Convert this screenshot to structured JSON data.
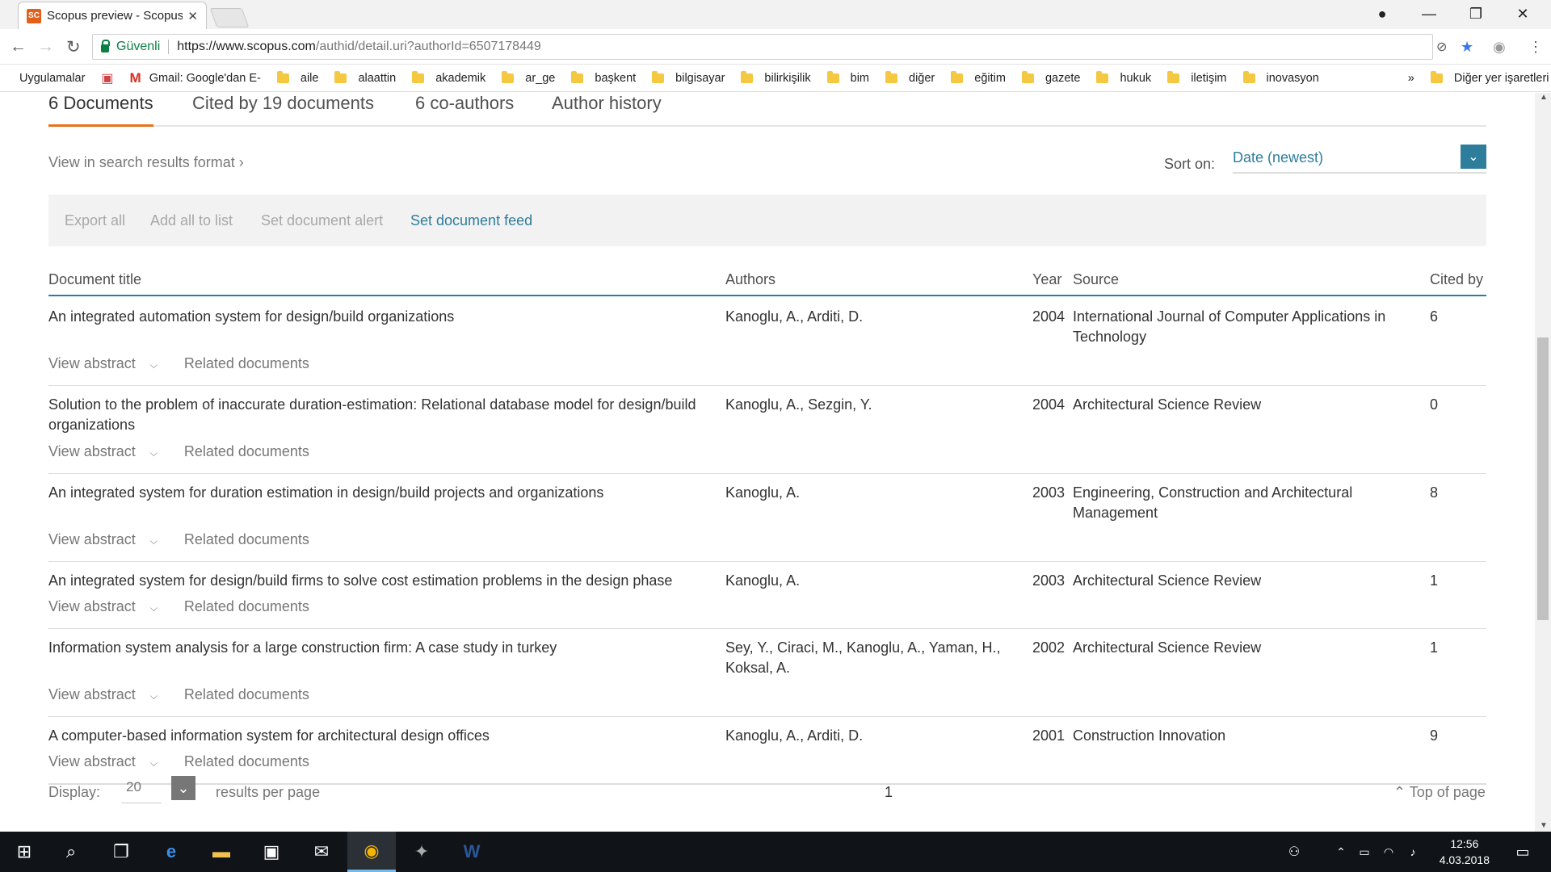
{
  "browser": {
    "tab_title": "Scopus preview - Scopus",
    "favicon_text": "SC",
    "secure_label": "Güvenli",
    "url_main": "https://www.scopus.com",
    "url_path": "/authid/detail.uri?authorId=6507178449"
  },
  "bookmarks": {
    "apps": "Uygulamalar",
    "gmail": "Gmail: Google'dan E-",
    "folders": [
      "aile",
      "alaattin",
      "akademik",
      "ar_ge",
      "başkent",
      "bilgisayar",
      "bilirkişilik",
      "bim",
      "diğer",
      "eğitim",
      "gazete",
      "hukuk",
      "iletişim",
      "inovasyon"
    ],
    "more": "»",
    "other": "Diğer yer işaretleri"
  },
  "tabs": [
    "6 Documents",
    "Cited by 19 documents",
    "6 co-authors",
    "Author history"
  ],
  "view_search": "View in search results format",
  "sort": {
    "label": "Sort on:",
    "value": "Date (newest)"
  },
  "actions": {
    "export": "Export all",
    "add": "Add all to list",
    "alert": "Set document alert",
    "feed": "Set document feed"
  },
  "columns": {
    "title": "Document title",
    "authors": "Authors",
    "year": "Year",
    "source": "Source",
    "cited": "Cited by"
  },
  "row_links": {
    "abstract": "View abstract",
    "related": "Related documents"
  },
  "documents": [
    {
      "title": "An integrated automation system for design/build organizations",
      "authors": "Kanoglu, A., Arditi, D.",
      "year": "2004",
      "source": "International Journal of Computer Applications in Technology",
      "cited": "6"
    },
    {
      "title": "Solution to the problem of inaccurate duration-estimation: Relational database model for design/build organizations",
      "authors": "Kanoglu, A., Sezgin, Y.",
      "year": "2004",
      "source": "Architectural Science Review",
      "cited": "0"
    },
    {
      "title": "An integrated system for duration estimation in design/build projects and organizations",
      "authors": "Kanoglu, A.",
      "year": "2003",
      "source": "Engineering, Construction and Architectural Management",
      "cited": "8"
    },
    {
      "title": "An integrated system for design/build firms to solve cost estimation problems in the design phase",
      "authors": "Kanoglu, A.",
      "year": "2003",
      "source": "Architectural Science Review",
      "cited": "1"
    },
    {
      "title": "Information system analysis for a large construction firm: A case study in turkey",
      "authors": "Sey, Y., Ciraci, M., Kanoglu, A., Yaman, H., Koksal, A.",
      "year": "2002",
      "source": "Architectural Science Review",
      "cited": "1"
    },
    {
      "title": "A computer-based information system for architectural design offices",
      "authors": "Kanoglu, A., Arditi, D.",
      "year": "2001",
      "source": "Construction Innovation",
      "cited": "9"
    }
  ],
  "footer": {
    "display": "Display:",
    "display_value": "20",
    "per_page": "results per page",
    "page": "1",
    "top": "Top of page"
  },
  "taskbar": {
    "time": "12:56",
    "date": "4.03.2018"
  }
}
